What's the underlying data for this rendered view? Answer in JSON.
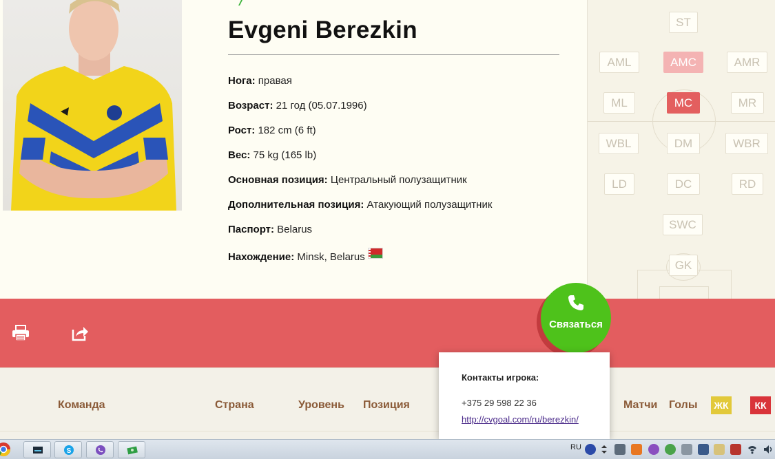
{
  "player": {
    "name": "Evgeni Berezkin"
  },
  "info": [
    {
      "key": "Нога:",
      "value": "правая"
    },
    {
      "key": "Возраст:",
      "value": "21 год (05.07.1996)"
    },
    {
      "key": "Рост:",
      "value": "182 cm (6 ft)"
    },
    {
      "key": "Вес:",
      "value": "75 kg (165 lb)"
    },
    {
      "key": "Основная позиция:",
      "value": "Центральный полузащитник"
    },
    {
      "key": "Дополнительная позиция:",
      "value": "Атакующий полузащитник"
    },
    {
      "key": "Паспорт:",
      "value": "Belarus"
    },
    {
      "key": "Нахождение:",
      "value": "Minsk, Belarus"
    }
  ],
  "pitch": {
    "ST": "ST",
    "AML": "AML",
    "AMC": "AMC",
    "AMR": "AMR",
    "ML": "ML",
    "MC": "MC",
    "MR": "MR",
    "WBL": "WBL",
    "DM": "DM",
    "WBR": "WBR",
    "LD": "LD",
    "DC": "DC",
    "RD": "RD",
    "SWC": "SWC",
    "GK": "GK",
    "primary_position": "MC",
    "secondary_position": "AMC"
  },
  "actions": {
    "contact_label": "Связаться",
    "print_icon": "printer-icon",
    "share_icon": "share-icon"
  },
  "stats_columns": {
    "team": "Команда",
    "country": "Страна",
    "level": "Уровень",
    "position": "Позиция",
    "matches": "Матчи",
    "goals": "Голы",
    "yellow_cards": "ЖК",
    "red_cards": "КК"
  },
  "contact_popup": {
    "title": "Контакты игрока:",
    "phone": "+375 29 598 22 36",
    "link": "http://cvgoal.com/ru/berezkin/"
  },
  "taskbar": {
    "language": "RU"
  },
  "colors": {
    "accent_red": "#e35d5f",
    "contact_green": "#4ec21b",
    "label_brown": "#8a5a37",
    "yellow_card": "#e2c93a",
    "red_card": "#d9343a"
  }
}
